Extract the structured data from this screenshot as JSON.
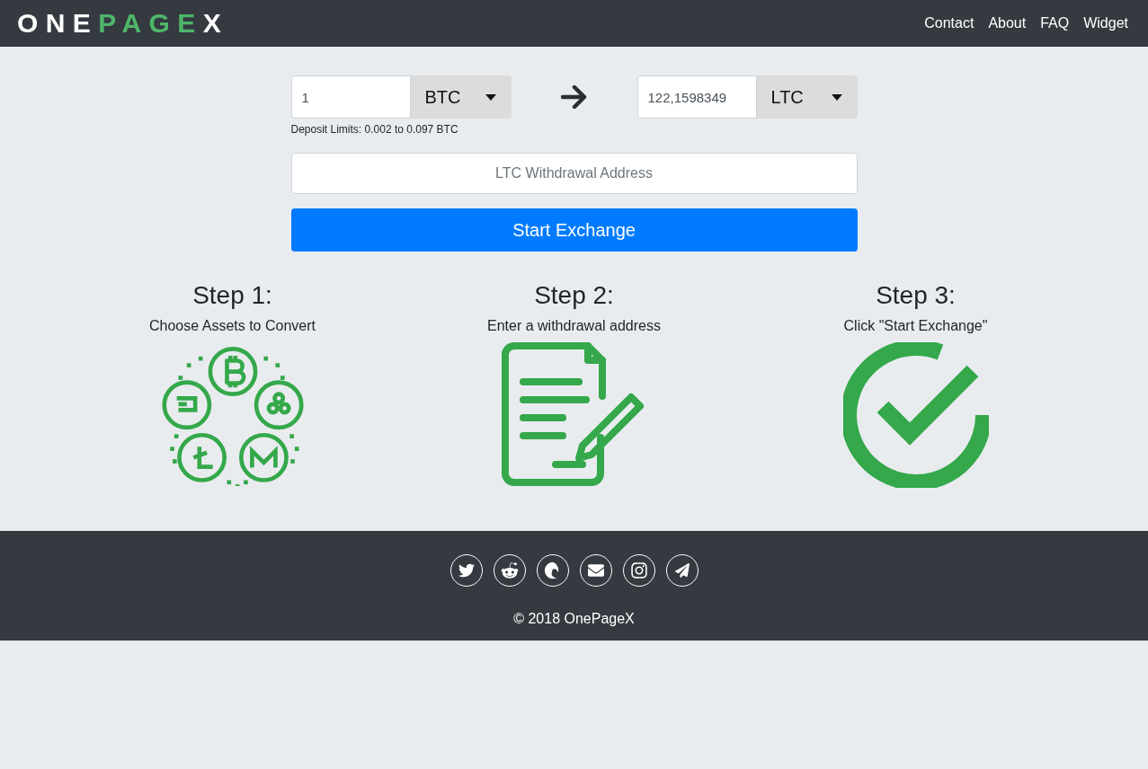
{
  "header": {
    "logo": [
      {
        "text": "ONE",
        "accent": false
      },
      {
        "text": "PAGE",
        "accent": true
      },
      {
        "text": "X",
        "accent": false
      }
    ],
    "nav": [
      "Contact",
      "About",
      "FAQ",
      "Widget"
    ]
  },
  "exchange": {
    "from": {
      "value": "1",
      "currency": "BTC"
    },
    "to": {
      "value": "122,1598349",
      "currency": "LTC"
    },
    "deposit_limits": "Deposit Limits: 0.002 to 0.097 BTC",
    "address": {
      "placeholder": "LTC Withdrawal Address"
    },
    "button": "Start Exchange"
  },
  "steps": [
    {
      "title": "Step 1:",
      "text": "Choose Assets to Convert",
      "kind": "coins"
    },
    {
      "title": "Step 2:",
      "text": "Enter a withdrawal address",
      "kind": "document"
    },
    {
      "title": "Step 3:",
      "text": "Click \"Start Exchange\"",
      "kind": "check"
    }
  ],
  "footer": {
    "social": [
      {
        "kind": "twitter"
      },
      {
        "kind": "reddit"
      },
      {
        "kind": "swirl"
      },
      {
        "kind": "mail"
      },
      {
        "kind": "instagram"
      },
      {
        "kind": "telegram"
      }
    ],
    "copyright": "© 2018 OnePageX"
  }
}
